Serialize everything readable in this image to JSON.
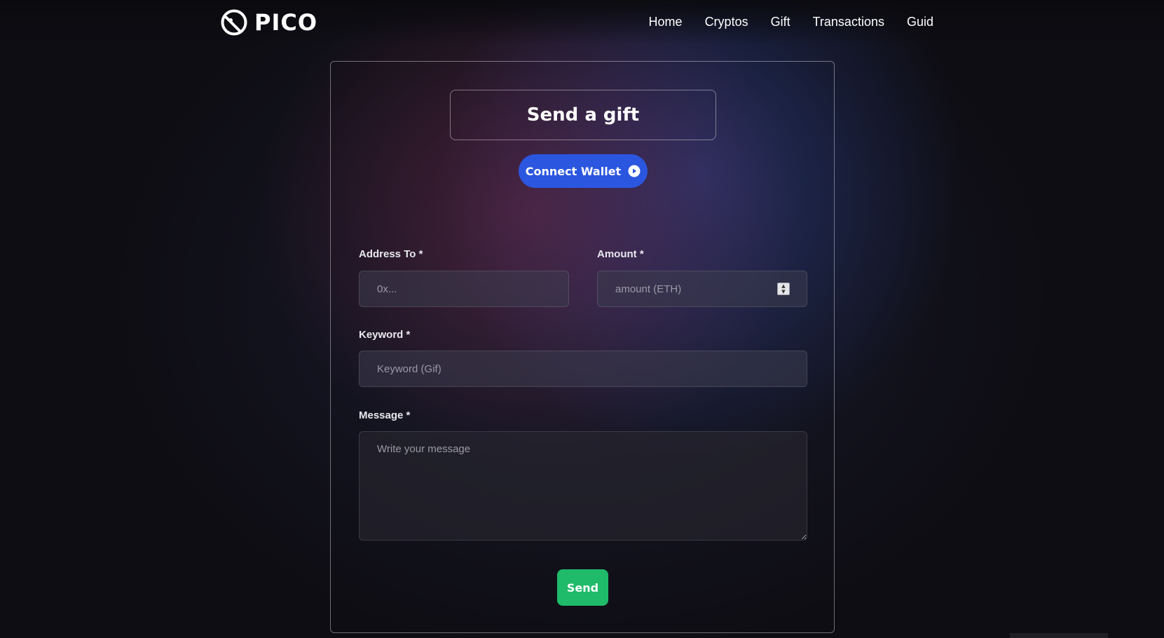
{
  "header": {
    "logo_text": "PICO",
    "nav": [
      "Home",
      "Cryptos",
      "Gift",
      "Transactions",
      "Guid"
    ]
  },
  "form": {
    "title": "Send a gift",
    "connect_wallet_label": "Connect Wallet",
    "address_label": "Address To *",
    "address_placeholder": "0x...",
    "amount_label": "Amount *",
    "amount_placeholder": "amount (ETH)",
    "keyword_label": "Keyword *",
    "keyword_placeholder": "Keyword (Gif)",
    "message_label": "Message *",
    "message_placeholder": "Write your message",
    "send_label": "Send"
  },
  "colors": {
    "background": "#0e0d13",
    "connect_button": "#2b56e0",
    "send_button": "#1fbb6a"
  }
}
